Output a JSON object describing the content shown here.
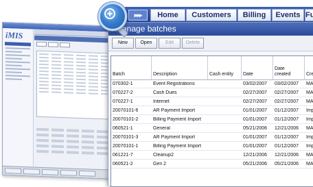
{
  "nav": {
    "arrows_label": "▸▸▸",
    "tabs": [
      "Home",
      "Customers",
      "Billing",
      "Events",
      "Fundr"
    ]
  },
  "page": {
    "title": "Manage batches"
  },
  "toolbar": {
    "buttons": [
      {
        "label": "New",
        "enabled": true
      },
      {
        "label": "Open",
        "enabled": true
      },
      {
        "label": "Edit",
        "enabled": false
      },
      {
        "label": "Delete",
        "enabled": false
      }
    ]
  },
  "grid": {
    "columns": [
      "Batch",
      "Description",
      "Cash entity",
      "Date",
      "Date created",
      "Crea"
    ],
    "rows": [
      [
        "070302-1",
        "Event Registrations",
        "",
        "03/02/2007",
        "03/02/2007",
        "MAN"
      ],
      [
        "070227-2",
        "Cash Dues",
        "",
        "02/27/2007",
        "02/27/2007",
        "MAN"
      ],
      [
        "070227-1",
        "Internet",
        "",
        "02/27/2007",
        "02/27/2007",
        "MAN"
      ],
      [
        "20070101-6",
        "AR Payment Import",
        "",
        "01/01/2007",
        "01/12/2007",
        "Impo"
      ],
      [
        "20070101-2",
        "Billing Payment Import",
        "",
        "01/01/2007",
        "01/12/2007",
        "Impo"
      ],
      [
        "060521-1",
        "General",
        "",
        "05/21/2006",
        "12/21/2006",
        "MAN"
      ],
      [
        "20070101-3",
        "AR Payment Import",
        "",
        "01/01/2007",
        "01/12/2007",
        "Impo"
      ],
      [
        "20070101-1",
        "Billing Payment Import",
        "",
        "01/01/2007",
        "01/12/2007",
        "Impo"
      ],
      [
        "061221-7",
        "Cleanup2",
        "",
        "12/21/2006",
        "12/21/2006",
        "MAN"
      ],
      [
        "060521-2",
        "Gen 2",
        "",
        "05/21/2006",
        "05/21/2006",
        "MAN"
      ]
    ]
  },
  "background_app": {
    "logo": "iMIS"
  },
  "icons": {
    "zoom": "magnifier-plus-icon"
  },
  "colors": {
    "nav_blue": "#2b4a97",
    "header_blue": "#3b5caa",
    "lens_blue": "#3a7fcf"
  }
}
